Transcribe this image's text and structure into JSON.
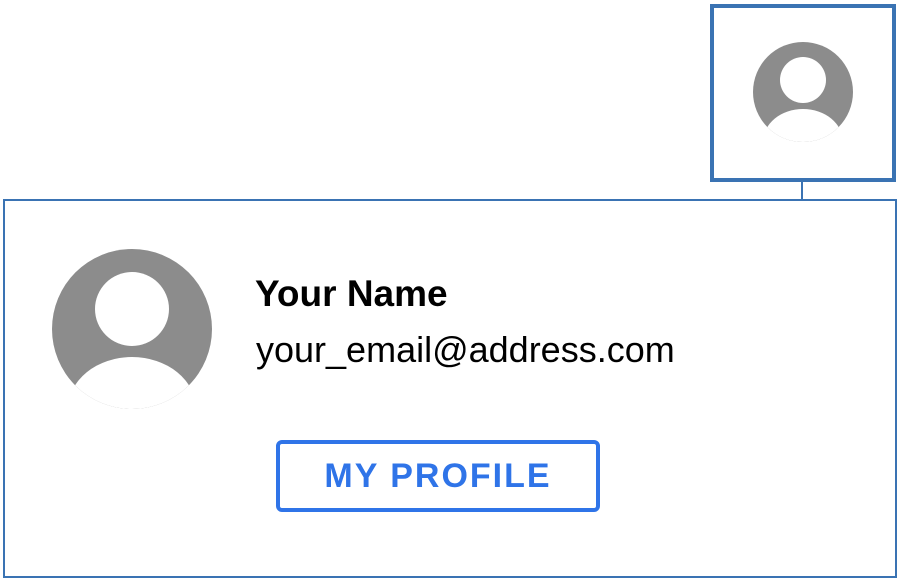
{
  "user": {
    "name": "Your Name",
    "email": "your_email@address.com"
  },
  "profile_menu": {
    "my_profile_label": "MY PROFILE"
  },
  "icons": {
    "avatar_trigger": "person-icon",
    "card_avatar": "person-icon"
  },
  "colors": {
    "frame": "#3a73b3",
    "button_accent": "#2f74e8",
    "avatar_gray": "#8c8c8c"
  }
}
